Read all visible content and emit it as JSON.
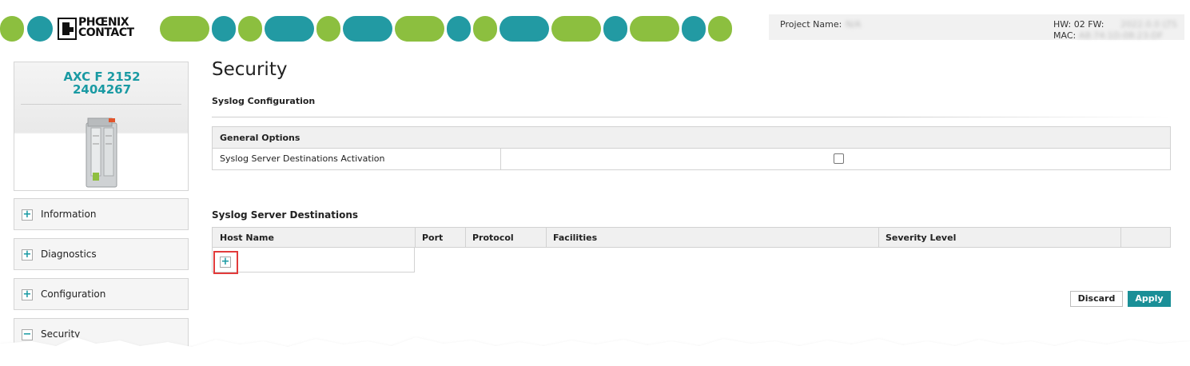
{
  "brand": {
    "logo_text_line1": "PHŒNIX",
    "logo_text_line2": "CONTACT",
    "colors": {
      "green": "#8cbf3f",
      "teal": "#229aa3"
    }
  },
  "header_info": {
    "project_name_label": "Project Name:",
    "project_name_value": "N/A",
    "hw_fw_label": "HW: 02 FW:",
    "fw_value": "2022.0.0 LTS",
    "mac_label": "MAC:",
    "mac_value": "A8:74:1D:08:23:DF"
  },
  "device": {
    "name": "AXC F 2152",
    "part_number": "2404267"
  },
  "sidebar": {
    "items": [
      {
        "label": "Information",
        "icon": "plus-icon",
        "expanded": false
      },
      {
        "label": "Diagnostics",
        "icon": "plus-icon",
        "expanded": false
      },
      {
        "label": "Configuration",
        "icon": "plus-icon",
        "expanded": false
      },
      {
        "label": "Security",
        "icon": "minus-icon",
        "expanded": true
      }
    ]
  },
  "main": {
    "title": "Security",
    "subtitle": "Syslog Configuration",
    "general_options": {
      "header": "General Options",
      "rows": [
        {
          "label": "Syslog Server Destinations Activation",
          "checked": false
        }
      ]
    },
    "destinations": {
      "title": "Syslog Server Destinations",
      "columns": [
        "Host Name",
        "Port",
        "Protocol",
        "Facilities",
        "Severity Level",
        ""
      ],
      "rows": []
    },
    "buttons": {
      "discard": "Discard",
      "apply": "Apply"
    }
  },
  "accent_color": "#1a9aa3",
  "highlight_color": "#e23b3b"
}
